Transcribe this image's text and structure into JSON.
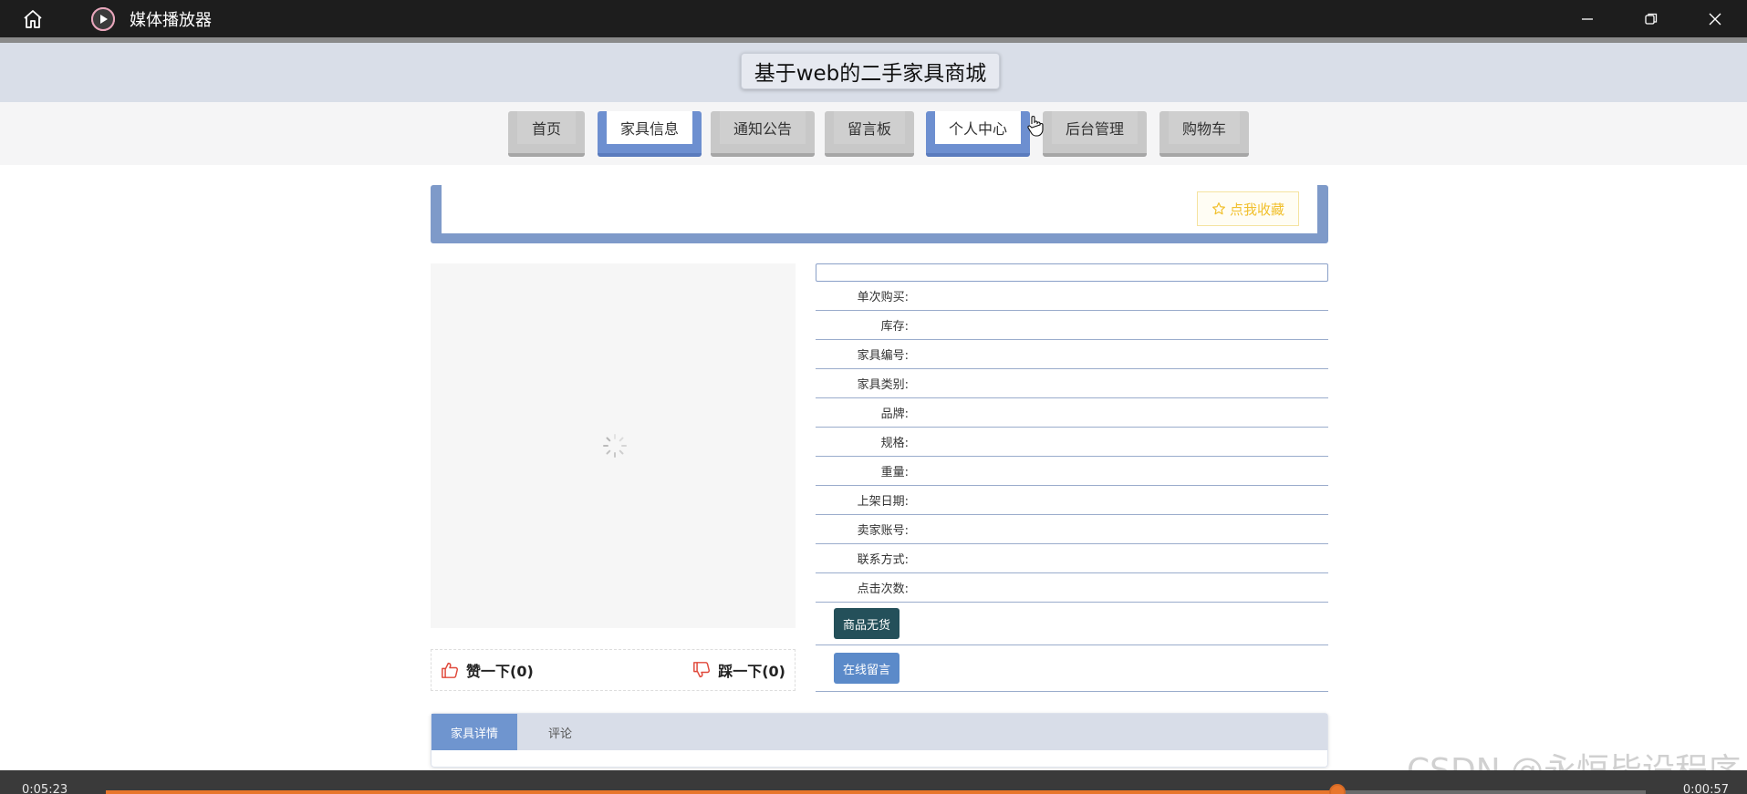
{
  "player": {
    "title": "媒体播放器",
    "time_current": "0:05:23",
    "time_total": "0:00:57",
    "progress": 0.8
  },
  "site": {
    "title": "基于web的二手家具商城"
  },
  "nav": {
    "items": [
      {
        "label": "首页"
      },
      {
        "label": "家具信息"
      },
      {
        "label": "通知公告"
      },
      {
        "label": "留言板"
      },
      {
        "label": "个人中心"
      },
      {
        "label": "后台管理"
      },
      {
        "label": "购物车"
      }
    ],
    "active": [
      "家具信息",
      "个人中心"
    ]
  },
  "banner": {
    "favorite_label": "点我收藏"
  },
  "votes": {
    "like_label": "赞一下(0)",
    "dislike_label": "踩一下(0)"
  },
  "info": {
    "rows": [
      {
        "label": "单次购买:"
      },
      {
        "label": "库存:"
      },
      {
        "label": "家具编号:"
      },
      {
        "label": "家具类别:"
      },
      {
        "label": "品牌:"
      },
      {
        "label": "规格:"
      },
      {
        "label": "重量:"
      },
      {
        "label": "上架日期:"
      },
      {
        "label": "卖家账号:"
      },
      {
        "label": "联系方式:"
      },
      {
        "label": "点击次数:"
      }
    ],
    "out_of_stock_label": "商品无货",
    "message_label": "在线留言"
  },
  "tabs": {
    "items": [
      {
        "label": "家具详情"
      },
      {
        "label": "评论"
      }
    ]
  },
  "watermark": "CSDN @永恒毕设程序",
  "colors": {
    "accent_blue": "#6f95cf",
    "button_dark": "#24505a",
    "button_blue": "#5b8ac9",
    "favorite_yellow": "#f1c02d",
    "progress_orange": "#e8762c"
  }
}
